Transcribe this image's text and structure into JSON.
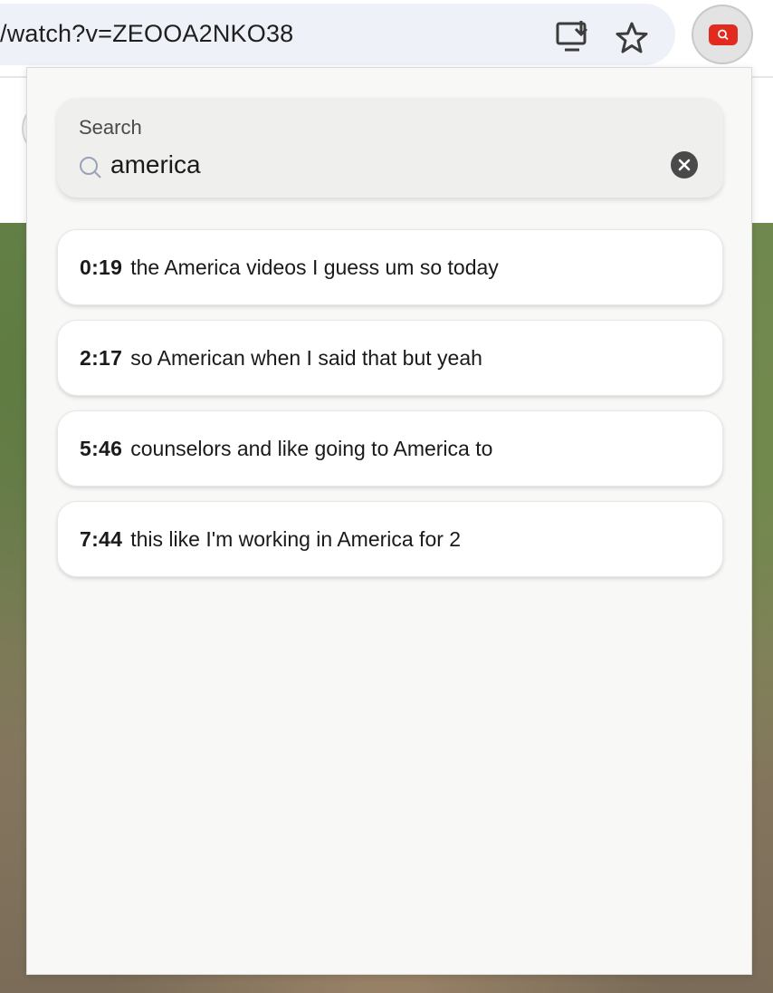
{
  "browser": {
    "url": "/watch?v=ZEOOA2NKO38",
    "icons": [
      "install-icon",
      "star-icon",
      "extension-icon"
    ]
  },
  "popup": {
    "search": {
      "label": "Search",
      "value": "america",
      "icon": "search-icon",
      "clear_icon": "close-icon"
    },
    "results": [
      {
        "timestamp": "0:19",
        "text": "the America videos I guess um so today"
      },
      {
        "timestamp": "2:17",
        "text": "so American when I said that but yeah"
      },
      {
        "timestamp": "5:46",
        "text": "counselors and like going to America to"
      },
      {
        "timestamp": "7:44",
        "text": "this like I'm working in America for 2"
      }
    ]
  },
  "colors": {
    "extension_accent": "#e22a1f",
    "popup_bg": "#f8f8f7",
    "search_bg": "#efefee"
  }
}
